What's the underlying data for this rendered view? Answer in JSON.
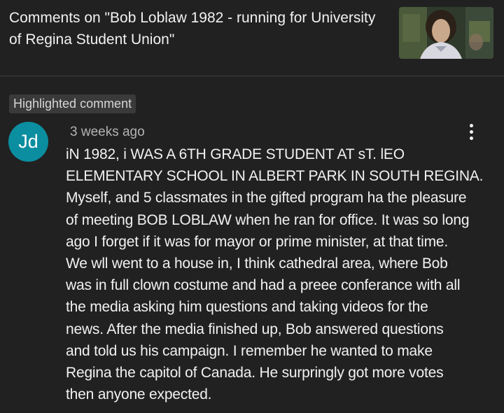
{
  "header": {
    "title": "Comments on \"Bob Loblaw 1982 - running for University of Regina Student Union\""
  },
  "thumbnail": {
    "icon": "video-thumbnail"
  },
  "comment": {
    "badge": "Highlighted comment",
    "avatar_initials": "Jd",
    "avatar_color": "#0b8ea0",
    "timestamp": "3 weeks ago",
    "text": "iN 1982, i WAS A 6TH GRADE STUDENT AT sT. lEO\nELEMENTARY SCHOOL IN ALBERT PARK IN SOUTH REGINA.\nMyself, and 5 classmates in the gifted program ha the pleasure\nof meeting BOB LOBLAW when he ran for office. It was so long\nago I forget if it was for mayor or prime minister, at that time.\nWe wll went to a house in, I think cathedral area, where Bob\nwas in full clown costume and had a preee conferance with all\nthe media asking him questions and taking videos for the\nnews. After the media finished up, Bob answered questions\nand told us his campaign. I remember he wanted to make\nRegina the capitol of Canada. He surpringly got more votes\nthen anyone expected."
  }
}
